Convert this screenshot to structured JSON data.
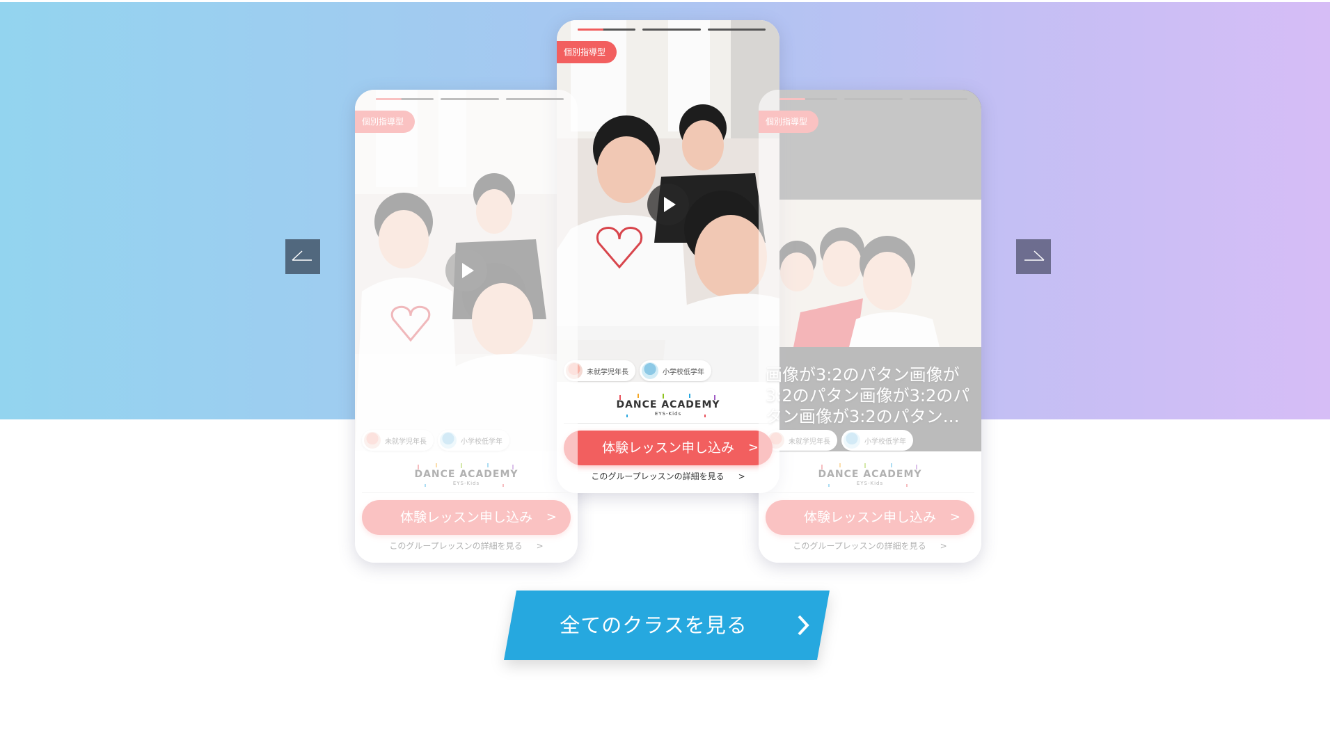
{
  "slides": {
    "left": {
      "badge": "個別指導型",
      "tags": [
        "未就学児年長",
        "小学校低学年"
      ],
      "brand_name": "DANCE ACADEMY",
      "brand_sub": "EYS-Kids",
      "cta_label": "体験レッスン申し込み",
      "detail_link": "このグループレッスンの詳細を見る"
    },
    "center": {
      "badge": "個別指導型",
      "tags": [
        "未就学児年長",
        "小学校低学年"
      ],
      "brand_name": "DANCE ACADEMY",
      "brand_sub": "EYS-Kids",
      "cta_label": "体験レッスン申し込み",
      "detail_link": "このグループレッスンの詳細を見る"
    },
    "right": {
      "badge": "個別指導型",
      "caption": "画像が3:2のパタン画像が3:2のパタン画像が3:2のパタン画像が3:2のパタン…",
      "tags": [
        "未就学児年長",
        "小学校低学年"
      ],
      "brand_name": "DANCE ACADEMY",
      "brand_sub": "EYS-Kids",
      "cta_label": "体験レッスン申し込み",
      "detail_link": "このグループレッスンの詳細を見る"
    }
  },
  "icons": {
    "prev": "arrow-left-icon",
    "next": "arrow-right-icon",
    "play": "play-icon",
    "chevron": "chevron-right-icon"
  },
  "chevron_glyph": ">",
  "view_all_button": {
    "label": "全てのクラスを見る"
  },
  "colors": {
    "accent": "#f25f5f",
    "button_blue": "#26a8df",
    "hero_gradient_start": "#93d4ef",
    "hero_gradient_end": "#d6bdf6"
  }
}
